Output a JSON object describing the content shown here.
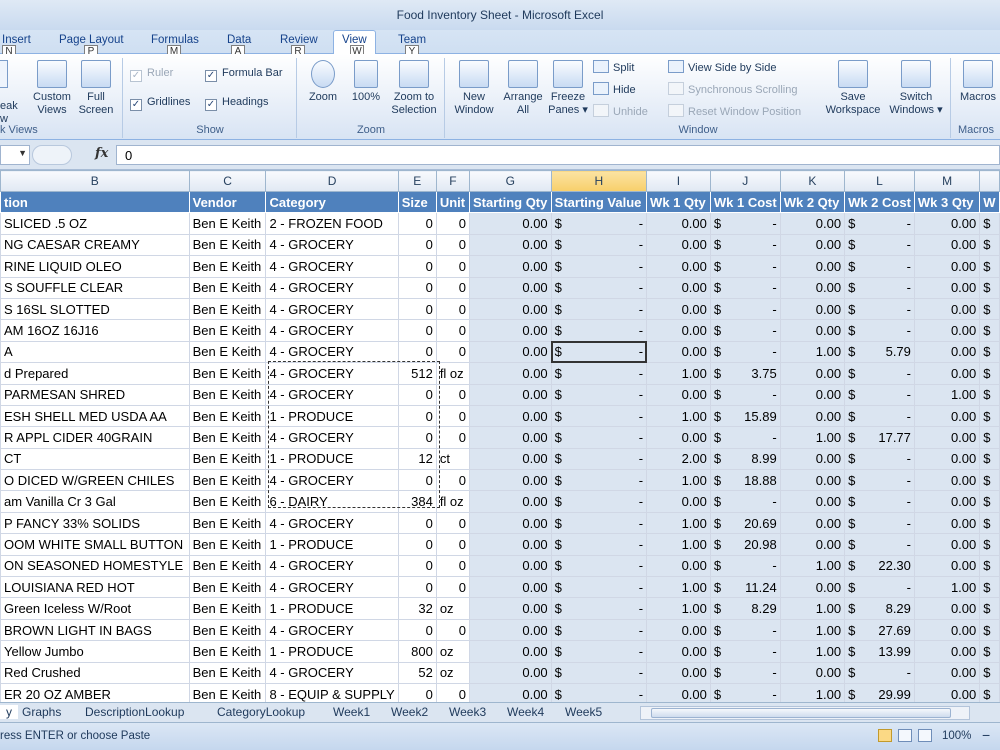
{
  "window": {
    "title": "Food Inventory Sheet  -  Microsoft Excel"
  },
  "ribbon_tabs": [
    {
      "label": "Insert",
      "keytip": "N"
    },
    {
      "label": "Page Layout",
      "keytip": "P"
    },
    {
      "label": "Formulas",
      "keytip": "M"
    },
    {
      "label": "Data",
      "keytip": "A"
    },
    {
      "label": "Review",
      "keytip": "R"
    },
    {
      "label": "View",
      "keytip": "W"
    },
    {
      "label": "Team",
      "keytip": "Y"
    }
  ],
  "ribbon": {
    "workbook_views": {
      "partial_top": "eak",
      "partial_bottom": "w",
      "custom_views": "Custom Views",
      "full_screen": "Full Screen",
      "group": "k Views"
    },
    "show": {
      "ruler": "Ruler",
      "formula_bar": "Formula Bar",
      "gridlines": "Gridlines",
      "headings": "Headings",
      "group": "Show"
    },
    "zoom": {
      "zoom": "Zoom",
      "hundred": "100%",
      "zoom_to_selection": "Zoom to Selection",
      "group": "Zoom"
    },
    "window": {
      "new_window": "New Window",
      "arrange_all": "Arrange All",
      "freeze_panes": "Freeze Panes ▾",
      "split": "Split",
      "hide": "Hide",
      "unhide": "Unhide",
      "view_side_by_side": "View Side by Side",
      "synchronous_scrolling": "Synchronous Scrolling",
      "reset_window_position": "Reset Window Position",
      "save_workspace": "Save Workspace",
      "switch_windows": "Switch Windows ▾",
      "group": "Window"
    },
    "macros": {
      "macros": "Macros",
      "group": "Macros"
    }
  },
  "formula_bar": {
    "fx": "fx",
    "value": "0"
  },
  "columns": [
    "B",
    "C",
    "D",
    "E",
    "F",
    "G",
    "H",
    "I",
    "J",
    "K",
    "L",
    "M"
  ],
  "header_row": {
    "description": "tion",
    "vendor": "Vendor",
    "category": "Category",
    "size": "Size",
    "unit": "Unit",
    "starting_qty": "Starting Qty",
    "starting_value": "Starting Value",
    "wk1_qty": "Wk 1 Qty",
    "wk1_cost": "Wk 1 Cost",
    "wk2_qty": "Wk 2 Qty",
    "wk2_cost": "Wk 2 Cost",
    "wk3_qty": "Wk 3 Qty",
    "extra": "W"
  },
  "rows": [
    [
      "SLICED .5 OZ",
      "Ben E Keith",
      "2 - FROZEN FOOD",
      "0",
      "0",
      "0.00",
      "-",
      "0.00",
      "-",
      "0.00",
      "-",
      "0.00"
    ],
    [
      "NG CAESAR CREAMY",
      "Ben E Keith",
      "4 - GROCERY",
      "0",
      "0",
      "0.00",
      "-",
      "0.00",
      "-",
      "0.00",
      "-",
      "0.00"
    ],
    [
      "RINE LIQUID OLEO",
      "Ben E Keith",
      "4 - GROCERY",
      "0",
      "0",
      "0.00",
      "-",
      "0.00",
      "-",
      "0.00",
      "-",
      "0.00"
    ],
    [
      "S SOUFFLE CLEAR",
      "Ben E Keith",
      "4 - GROCERY",
      "0",
      "0",
      "0.00",
      "-",
      "0.00",
      "-",
      "0.00",
      "-",
      "0.00"
    ],
    [
      "S 16SL SLOTTED",
      "Ben E Keith",
      "4 - GROCERY",
      "0",
      "0",
      "0.00",
      "-",
      "0.00",
      "-",
      "0.00",
      "-",
      "0.00"
    ],
    [
      "AM 16OZ 16J16",
      "Ben E Keith",
      "4 - GROCERY",
      "0",
      "0",
      "0.00",
      "-",
      "0.00",
      "-",
      "0.00",
      "-",
      "0.00"
    ],
    [
      "A",
      "Ben E Keith",
      "4 - GROCERY",
      "0",
      "0",
      "0.00",
      "-",
      "0.00",
      "-",
      "1.00",
      "5.79",
      "0.00"
    ],
    [
      "d Prepared",
      "Ben E Keith",
      "4 - GROCERY",
      "512",
      "fl oz",
      "0.00",
      "-",
      "1.00",
      "3.75",
      "0.00",
      "-",
      "0.00"
    ],
    [
      " PARMESAN SHRED",
      "Ben E Keith",
      "4 - GROCERY",
      "0",
      "0",
      "0.00",
      "-",
      "0.00",
      "-",
      "0.00",
      "-",
      "1.00"
    ],
    [
      "ESH SHELL MED USDA AA",
      "Ben E Keith",
      "1 - PRODUCE",
      "0",
      "0",
      "0.00",
      "-",
      "1.00",
      "15.89",
      "0.00",
      "-",
      "0.00"
    ],
    [
      "R APPL CIDER 40GRAIN",
      "Ben E Keith",
      "4 - GROCERY",
      "0",
      "0",
      "0.00",
      "-",
      "0.00",
      "-",
      "1.00",
      "17.77",
      "0.00"
    ],
    [
      " CT",
      "Ben E Keith",
      "1 - PRODUCE",
      "12",
      "ct",
      "0.00",
      "-",
      "2.00",
      "8.99",
      "0.00",
      "-",
      "0.00"
    ],
    [
      "O DICED W/GREEN CHILES",
      "Ben E Keith",
      "4 - GROCERY",
      "0",
      "0",
      "0.00",
      "-",
      "1.00",
      "18.88",
      "0.00",
      "-",
      "0.00"
    ],
    [
      "am Vanilla Cr 3 Gal",
      "Ben E Keith",
      "6 - DAIRY",
      "384",
      "fl oz",
      "0.00",
      "-",
      "0.00",
      "-",
      "0.00",
      "-",
      "0.00"
    ],
    [
      "P FANCY 33% SOLIDS",
      "Ben E Keith",
      "4 - GROCERY",
      "0",
      "0",
      "0.00",
      "-",
      "1.00",
      "20.69",
      "0.00",
      "-",
      "0.00"
    ],
    [
      "OOM WHITE SMALL BUTTON",
      "Ben E Keith",
      "1 - PRODUCE",
      "0",
      "0",
      "0.00",
      "-",
      "1.00",
      "20.98",
      "0.00",
      "-",
      "0.00"
    ],
    [
      "ON SEASONED HOMESTYLE",
      "Ben E Keith",
      "4 - GROCERY",
      "0",
      "0",
      "0.00",
      "-",
      "0.00",
      "-",
      "1.00",
      "22.30",
      "0.00"
    ],
    [
      "LOUISIANA RED HOT",
      "Ben E Keith",
      "4 - GROCERY",
      "0",
      "0",
      "0.00",
      "-",
      "1.00",
      "11.24",
      "0.00",
      "-",
      "1.00"
    ],
    [
      "Green Iceless W/Root",
      "Ben E Keith",
      "1 - PRODUCE",
      "32",
      "oz",
      "0.00",
      "-",
      "1.00",
      "8.29",
      "1.00",
      "8.29",
      "0.00"
    ],
    [
      "BROWN LIGHT IN BAGS",
      "Ben E Keith",
      "4 - GROCERY",
      "0",
      "0",
      "0.00",
      "-",
      "0.00",
      "-",
      "1.00",
      "27.69",
      "0.00"
    ],
    [
      "Yellow Jumbo",
      "Ben E Keith",
      "1 - PRODUCE",
      "800",
      "oz",
      "0.00",
      "-",
      "0.00",
      "-",
      "1.00",
      "13.99",
      "0.00"
    ],
    [
      " Red Crushed",
      "Ben E Keith",
      "4 - GROCERY",
      "52",
      "oz",
      "0.00",
      "-",
      "0.00",
      "-",
      "0.00",
      "-",
      "0.00"
    ],
    [
      "ER 20 OZ AMBER",
      "Ben E Keith",
      "8 - EQUIP & SUPPLY",
      "0",
      "0",
      "0.00",
      "-",
      "0.00",
      "-",
      "1.00",
      "29.99",
      "0.00"
    ]
  ],
  "currency_symbol": "$",
  "sheet_tabs": [
    "y",
    "Graphs",
    "DescriptionLookup",
    "CategoryLookup",
    "Week1",
    "Week2",
    "Week3",
    "Week4",
    "Week5"
  ],
  "status": {
    "message": "ress ENTER or choose Paste",
    "zoom": "100%",
    "zoom_out": "−"
  }
}
